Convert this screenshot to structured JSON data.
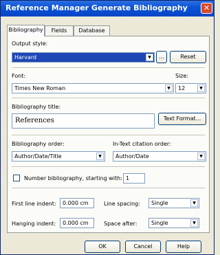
{
  "window": {
    "title": "Reference Manager Generate Bibliography",
    "close_glyph": "✕"
  },
  "tabs": [
    {
      "label": "Bibliography"
    },
    {
      "label": "Fields"
    },
    {
      "label": "Database"
    }
  ],
  "output_style": {
    "label": "Output style:",
    "value": "Harvard",
    "browse_label": "...",
    "reset_label": "Reset"
  },
  "font": {
    "label": "Font:",
    "value": "Times New Roman"
  },
  "size": {
    "label": "Size:",
    "value": "12"
  },
  "bib_title": {
    "label": "Bibliography title:",
    "value": "References",
    "text_format_label": "Text Format..."
  },
  "bib_order": {
    "label": "Bibliography order:",
    "value": "Author/Date/Title"
  },
  "intext_order": {
    "label": "In-Text citation order:",
    "value": "Author/Date"
  },
  "number_bib": {
    "label": "Number bibliography, starting with:",
    "value": "1",
    "checked": false
  },
  "first_indent": {
    "label": "First line indent:",
    "value": "0.000 cm"
  },
  "line_spacing": {
    "label": "Line spacing:",
    "value": "Single"
  },
  "hanging_indent": {
    "label": "Hanging indent:",
    "value": "0.000 cm"
  },
  "space_after": {
    "label": "Space after:",
    "value": "Single"
  },
  "buttons": {
    "ok": "OK",
    "cancel": "Cancel",
    "help": "Help"
  },
  "colors": {
    "titlebar": "#0a52d6",
    "selection": "#1f46b5",
    "dialog_bg": "#ece9d8"
  }
}
